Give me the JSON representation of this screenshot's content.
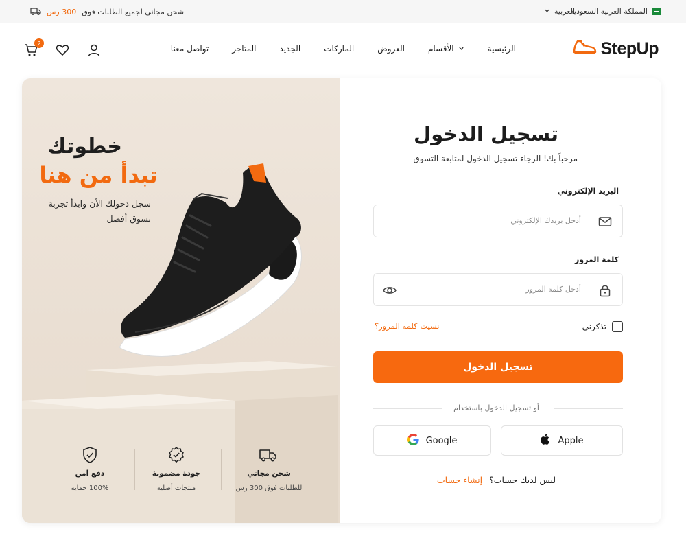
{
  "topbar": {
    "country": "المملكة العربية السعودية",
    "language": "العربية",
    "shipping_text": "شحن مجاني لجميع الطلبات فوق",
    "shipping_amount": "300 رس"
  },
  "header": {
    "logo": "StepUp",
    "nav": [
      "الرئيسية",
      "الأقسام",
      "العروض",
      "الماركات",
      "الجديد",
      "المتاجر",
      "تواصل معنا"
    ],
    "cart_count": "2"
  },
  "hero": {
    "title_line1": "خطوتك",
    "title_line2": "تبدأ من هنا",
    "subtitle": "سجل دخولك الأن وابدأ تجربة تسوق أفضل",
    "features": [
      {
        "title": "دفع آمن",
        "sub": "100% حماية",
        "icon": "shield-check-icon"
      },
      {
        "title": "جودة مضمونة",
        "sub": "منتجات أصلية",
        "icon": "quality-badge-icon"
      },
      {
        "title": "شحن مجاني",
        "sub": "للطلبات فوق 300 رس",
        "icon": "truck-icon"
      }
    ]
  },
  "login": {
    "title": "تسجيل الدخول",
    "subtitle": "مرحباً بك! الرجاء تسجيل الدخول لمتابعة التسوق",
    "email_label": "البريد الإلكتروني",
    "email_placeholder": "أدخل بريدك الإلكتروني",
    "password_label": "كلمة المرور",
    "password_placeholder": "أدخل كلمة المرور",
    "remember_me": "تذكرني",
    "forgot_password": "نسيت كلمة المرور؟",
    "submit": "تسجيل الدخول",
    "or_text": "أو تسجيل الدخول باستخدام",
    "apple": "Apple",
    "google": "Google",
    "no_account": "ليس لديك حساب؟",
    "create_account": "إنشاء حساب"
  },
  "colors": {
    "accent": "#f26a10",
    "hero_bg": "#ece3d8",
    "text": "#1c1c1c"
  }
}
